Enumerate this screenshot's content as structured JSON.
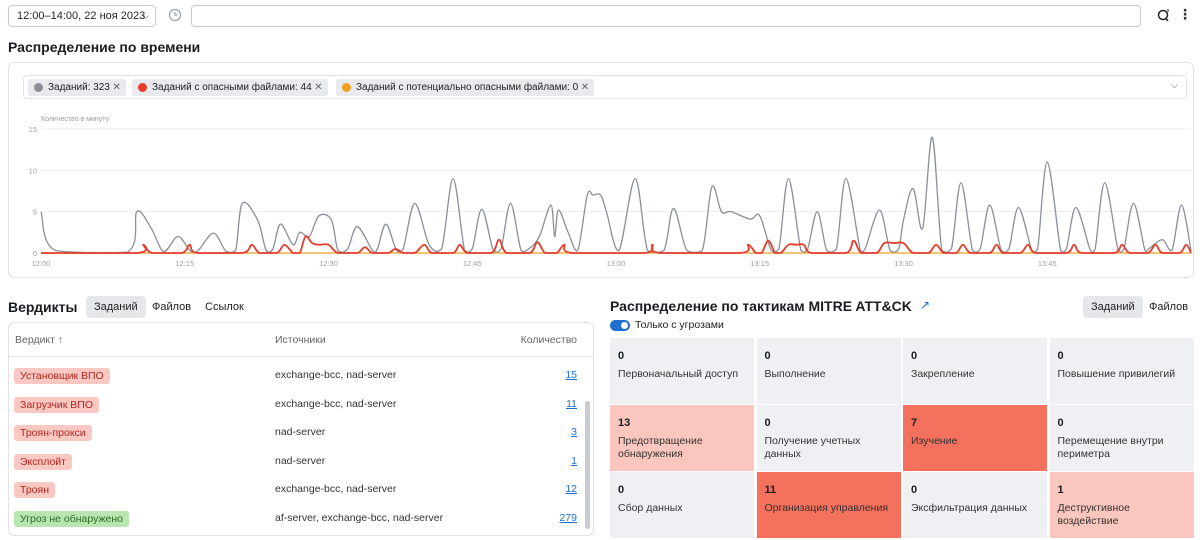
{
  "toolbar": {
    "time_range": "12:00–14:00, 22 ноя 2023",
    "query_placeholder": ""
  },
  "time_distribution": {
    "title": "Распределение по времени",
    "filters": [
      {
        "label": "Заданий: 323",
        "color": "#8a8f98"
      },
      {
        "label": "Заданий с опасными файлами: 44",
        "color": "#e53c2b"
      },
      {
        "label": "Заданий с потенциально опасными файлами: 0",
        "color": "#f0a020"
      }
    ]
  },
  "chart_data": {
    "type": "line",
    "ylabel": "Количество в минуту",
    "ylim": [
      0,
      15
    ],
    "yticks": [
      0,
      5,
      10,
      15
    ],
    "xlim": [
      0,
      120
    ],
    "xticks": [
      {
        "v": 0,
        "label": "12:00"
      },
      {
        "v": 15,
        "label": "12:15"
      },
      {
        "v": 30,
        "label": "12:30"
      },
      {
        "v": 45,
        "label": "12:45"
      },
      {
        "v": 60,
        "label": "13:00"
      },
      {
        "v": 75,
        "label": "13:15"
      },
      {
        "v": 90,
        "label": "13:30"
      },
      {
        "v": 105,
        "label": "13:45"
      }
    ],
    "grid": true,
    "series": [
      {
        "color": "#8a8f98",
        "points": [
          [
            0,
            5
          ],
          [
            1.5,
            0.3
          ],
          [
            9,
            0.1
          ],
          [
            10,
            5
          ],
          [
            11.5,
            3
          ],
          [
            12.8,
            0.2
          ],
          [
            14.3,
            2
          ],
          [
            15.6,
            0.2
          ],
          [
            16.4,
            0.3
          ],
          [
            18,
            2.4
          ],
          [
            19.3,
            0.2
          ],
          [
            20.3,
            0.3
          ],
          [
            21,
            6
          ],
          [
            22.6,
            4
          ],
          [
            23.5,
            0.3
          ],
          [
            24.2,
            0.5
          ],
          [
            25,
            3.5
          ],
          [
            26.3,
            1
          ],
          [
            27,
            2.5
          ],
          [
            28,
            2
          ],
          [
            29,
            4.5
          ],
          [
            30.3,
            4
          ],
          [
            31,
            0.3
          ],
          [
            32,
            0.5
          ],
          [
            33,
            3.2
          ],
          [
            34.6,
            0.3
          ],
          [
            35.1,
            0.5
          ],
          [
            36,
            3.5
          ],
          [
            37.1,
            0.3
          ],
          [
            37.8,
            0.5
          ],
          [
            39,
            6
          ],
          [
            40.5,
            1
          ],
          [
            41.8,
            0.5
          ],
          [
            43,
            9
          ],
          [
            44.2,
            0.3
          ],
          [
            45,
            0.5
          ],
          [
            46,
            5.3
          ],
          [
            47.2,
            0.3
          ],
          [
            48,
            0.5
          ],
          [
            49,
            6
          ],
          [
            50.1,
            0.3
          ],
          [
            51,
            0.6
          ],
          [
            52,
            2
          ],
          [
            53.2,
            5.8
          ],
          [
            53.6,
            2
          ],
          [
            54,
            5.2
          ],
          [
            55,
            2.5
          ],
          [
            56,
            0.3
          ],
          [
            57,
            7
          ],
          [
            57.6,
            7
          ],
          [
            58.4,
            7
          ],
          [
            59,
            5
          ],
          [
            60.3,
            0.3
          ],
          [
            62,
            9
          ],
          [
            63.3,
            0.3
          ],
          [
            65,
            0.3
          ],
          [
            66,
            5.4
          ],
          [
            67.4,
            0.3
          ],
          [
            69,
            0.3
          ],
          [
            70,
            8
          ],
          [
            71,
            5
          ],
          [
            72,
            5
          ],
          [
            74,
            4.1
          ],
          [
            75,
            4.5
          ],
          [
            76.2,
            0.3
          ],
          [
            77,
            0.5
          ],
          [
            78,
            9
          ],
          [
            79.3,
            0.3
          ],
          [
            80,
            0.5
          ],
          [
            81,
            5
          ],
          [
            82,
            0.3
          ],
          [
            83,
            0.5
          ],
          [
            84,
            9
          ],
          [
            85.5,
            0.3
          ],
          [
            86,
            0.5
          ],
          [
            87.5,
            5.2
          ],
          [
            88.6,
            0.3
          ],
          [
            89.5,
            0.5
          ],
          [
            90,
            4
          ],
          [
            91,
            7.8
          ],
          [
            92,
            3
          ],
          [
            93,
            14
          ],
          [
            94,
            0.3
          ],
          [
            95,
            0.5
          ],
          [
            96,
            8.5
          ],
          [
            97.2,
            0.3
          ],
          [
            98,
            0.5
          ],
          [
            99,
            5.8
          ],
          [
            100.2,
            0.3
          ],
          [
            101,
            0.5
          ],
          [
            102,
            5.5
          ],
          [
            103.4,
            0.3
          ],
          [
            104,
            0.5
          ],
          [
            105,
            11
          ],
          [
            106.4,
            0.3
          ],
          [
            107,
            0.5
          ],
          [
            108,
            5.5
          ],
          [
            109.5,
            0.3
          ],
          [
            110,
            0.5
          ],
          [
            111,
            8.5
          ],
          [
            112.4,
            0.3
          ],
          [
            113,
            0.5
          ],
          [
            114,
            6
          ],
          [
            115.2,
            0.3
          ],
          [
            115.6,
            0.5
          ],
          [
            117,
            1.6
          ],
          [
            118,
            0.3
          ],
          [
            119,
            5.8
          ],
          [
            120,
            0.3
          ]
        ]
      },
      {
        "color": "#e53c2b",
        "points": [
          [
            0,
            0
          ],
          [
            10,
            0
          ],
          [
            10.7,
            1
          ],
          [
            11.6,
            0
          ],
          [
            14.7,
            0
          ],
          [
            15.5,
            1
          ],
          [
            16.3,
            0
          ],
          [
            21,
            0
          ],
          [
            22,
            1
          ],
          [
            22.8,
            0
          ],
          [
            24.6,
            0
          ],
          [
            25.4,
            1
          ],
          [
            26.3,
            0
          ],
          [
            27,
            0
          ],
          [
            27.6,
            2
          ],
          [
            28.3,
            1.2
          ],
          [
            29,
            1
          ],
          [
            30,
            1
          ],
          [
            31,
            0
          ],
          [
            33,
            0
          ],
          [
            33.8,
            0.7
          ],
          [
            34.6,
            0
          ],
          [
            36.2,
            0
          ],
          [
            37,
            0.5
          ],
          [
            37.8,
            0
          ],
          [
            39,
            0
          ],
          [
            40,
            1
          ],
          [
            40.8,
            0
          ],
          [
            43,
            0
          ],
          [
            43.7,
            1
          ],
          [
            44.5,
            0
          ],
          [
            47,
            0
          ],
          [
            47.8,
            1.6
          ],
          [
            48.6,
            0
          ],
          [
            51,
            0
          ],
          [
            51.8,
            1.3
          ],
          [
            52.6,
            0
          ],
          [
            53.8,
            0
          ],
          [
            54.6,
            1
          ],
          [
            55.4,
            0
          ],
          [
            63,
            0
          ],
          [
            63.8,
            1
          ],
          [
            64.6,
            0
          ],
          [
            73,
            0
          ],
          [
            73.8,
            1
          ],
          [
            74.6,
            0
          ],
          [
            75.2,
            0
          ],
          [
            75.9,
            1.5
          ],
          [
            76.6,
            0
          ],
          [
            77.2,
            0
          ],
          [
            78,
            1
          ],
          [
            78.8,
            1
          ],
          [
            79.6,
            1
          ],
          [
            80.4,
            0
          ],
          [
            84,
            0
          ],
          [
            84.8,
            1.5
          ],
          [
            85.6,
            0
          ],
          [
            87.2,
            0
          ],
          [
            88,
            1.2
          ],
          [
            89,
            1.2
          ],
          [
            90,
            1.2
          ],
          [
            91,
            0
          ],
          [
            92.6,
            0
          ],
          [
            93.4,
            1
          ],
          [
            94.2,
            0
          ],
          [
            95.5,
            0
          ],
          [
            96.2,
            1
          ],
          [
            97,
            0
          ],
          [
            99,
            0
          ],
          [
            99.7,
            1
          ],
          [
            100.4,
            0
          ],
          [
            102.2,
            0
          ],
          [
            103,
            1
          ],
          [
            103.8,
            0
          ],
          [
            107,
            0
          ],
          [
            107.8,
            1
          ],
          [
            108.6,
            0
          ],
          [
            112,
            0
          ],
          [
            112.8,
            1
          ],
          [
            113.6,
            0
          ],
          [
            115.5,
            0
          ],
          [
            116.3,
            1
          ],
          [
            117,
            0
          ],
          [
            118.8,
            0
          ],
          [
            119.5,
            1
          ],
          [
            120,
            0
          ]
        ]
      },
      {
        "color": "#f0a020",
        "points": [
          [
            0,
            0
          ],
          [
            120,
            0
          ]
        ]
      }
    ]
  },
  "verdicts": {
    "title": "Вердикты",
    "tabs": [
      "Заданий",
      "Файлов",
      "Ссылок"
    ],
    "columns": {
      "verdict": "Вердикт",
      "sources": "Источники",
      "count": "Количество"
    },
    "rows": [
      {
        "verdict": "Установщик ВПО",
        "sources": "exchange-bcc, nad-server",
        "count": "15",
        "bg": "#f9c8c3",
        "fg": "#b3261e"
      },
      {
        "verdict": "Загрузчик ВПО",
        "sources": "exchange-bcc, nad-server",
        "count": "11",
        "bg": "#f9c8c3",
        "fg": "#b3261e"
      },
      {
        "verdict": "Троян-прокси",
        "sources": "nad-server",
        "count": "3",
        "bg": "#f9c8c3",
        "fg": "#b3261e"
      },
      {
        "verdict": "Эксплойт",
        "sources": "nad-server",
        "count": "1",
        "bg": "#f9c8c3",
        "fg": "#b3261e"
      },
      {
        "verdict": "Троян",
        "sources": "exchange-bcc, nad-server",
        "count": "12",
        "bg": "#f9c8c3",
        "fg": "#b3261e"
      },
      {
        "verdict": "Угроз не обнаружено",
        "sources": "af-server, exchange-bcc, nad-server",
        "count": "279",
        "bg": "#b9e6b0",
        "fg": "#2d6b25"
      }
    ]
  },
  "mitre": {
    "title": "Распределение по тактикам MITRE ATT&CK",
    "tabs": [
      "Заданий",
      "Файлов"
    ],
    "toggle_label": "Только с угрозами",
    "tactics": [
      {
        "count": "0",
        "name": "Первоначальный доступ",
        "bg": "#eef0f3"
      },
      {
        "count": "0",
        "name": "Выполнение",
        "bg": "#eef0f3"
      },
      {
        "count": "0",
        "name": "Закрепление",
        "bg": "#eef0f3"
      },
      {
        "count": "0",
        "name": "Повышение привилегий",
        "bg": "#eef0f3"
      },
      {
        "count": "13",
        "name": "Предотвращение обнаружения",
        "bg": "#fbc6bd"
      },
      {
        "count": "0",
        "name": "Получение учетных данных",
        "bg": "#eef0f3"
      },
      {
        "count": "7",
        "name": "Изучение",
        "bg": "#f4715d"
      },
      {
        "count": "0",
        "name": "Перемещение внутри периметра",
        "bg": "#eef0f3"
      },
      {
        "count": "0",
        "name": "Сбор данных",
        "bg": "#eef0f3"
      },
      {
        "count": "11",
        "name": "Организация управления",
        "bg": "#f4715d"
      },
      {
        "count": "0",
        "name": "Эксфильтрация данных",
        "bg": "#eef0f3"
      },
      {
        "count": "1",
        "name": "Деструктивное воздействие",
        "bg": "#fbc6bd"
      }
    ]
  }
}
